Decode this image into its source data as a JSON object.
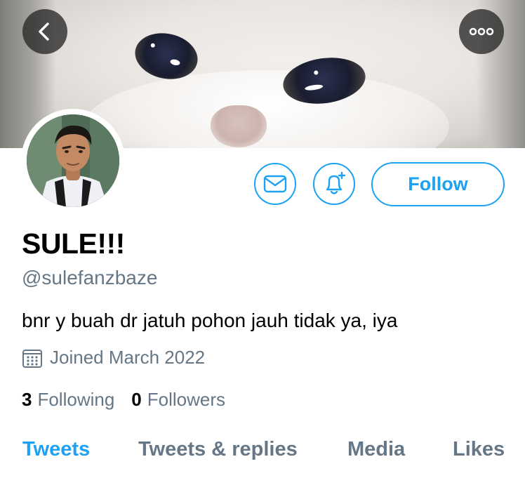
{
  "header": {
    "back_icon": "chevron-left-icon",
    "more_icon": "more-horizontal-icon"
  },
  "actions": {
    "message_icon": "mail-icon",
    "notify_icon": "bell-plus-icon",
    "follow_label": "Follow"
  },
  "profile": {
    "name": "SULE!!!",
    "handle": "@sulefanzbaze",
    "bio": "bnr y buah dr jatuh pohon jauh tidak ya, iya",
    "joined": "Joined March 2022",
    "following_count": "3",
    "following_label": "Following",
    "followers_count": "0",
    "followers_label": "Followers"
  },
  "tabs": [
    {
      "label": "Tweets",
      "active": true
    },
    {
      "label": "Tweets & replies",
      "active": false
    },
    {
      "label": "Media",
      "active": false
    },
    {
      "label": "Likes",
      "active": false
    }
  ],
  "colors": {
    "accent": "#1da1f2",
    "secondary_text": "#657786"
  }
}
